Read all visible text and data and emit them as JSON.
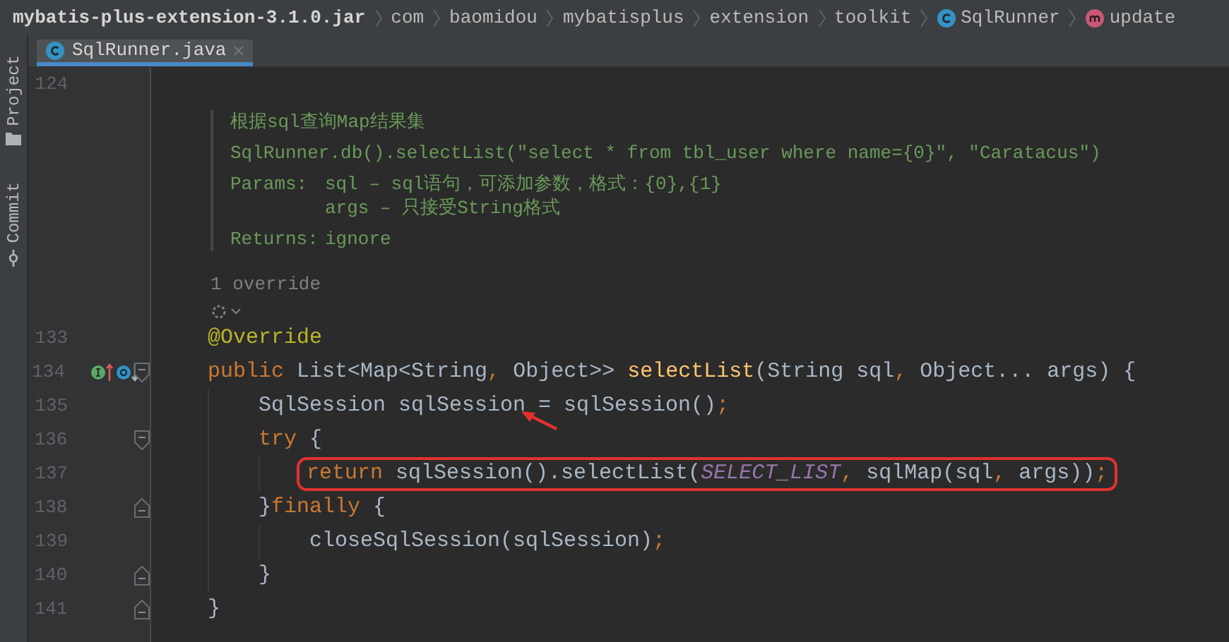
{
  "breadcrumbs": [
    {
      "text": "mybatis-plus-extension-3.1.0.jar",
      "kind": "archive"
    },
    {
      "text": "com",
      "kind": "package"
    },
    {
      "text": "baomidou",
      "kind": "package"
    },
    {
      "text": "mybatisplus",
      "kind": "package"
    },
    {
      "text": "extension",
      "kind": "package"
    },
    {
      "text": "toolkit",
      "kind": "package"
    },
    {
      "text": "SqlRunner",
      "kind": "class"
    },
    {
      "text": "update",
      "kind": "method"
    }
  ],
  "side_tabs": [
    {
      "label": "Project",
      "kind": "folder"
    },
    {
      "label": "Commit",
      "kind": "commit"
    }
  ],
  "tabs": [
    {
      "label": "SqlRunner.java",
      "selected": true
    }
  ],
  "editor": {
    "first_line": {
      "number": "124"
    },
    "doc": {
      "summary": "根据sql查询Map结果集",
      "example": "SqlRunner.db().selectList(\"select * from tbl_user where name={0}\", \"Caratacus\")",
      "params_label": "Params:",
      "params": [
        "sql – sql语句，可添加参数，格式：{0},{1}",
        "args – 只接受String格式"
      ],
      "returns_label": "Returns:",
      "returns": "ignore"
    },
    "usage_hint": "1 override",
    "lines": [
      {
        "number": "133",
        "tokens": [
          {
            "text": "@Override",
            "kind": "annotation"
          }
        ]
      },
      {
        "number": "134",
        "fold_start": true,
        "implements": true,
        "overridden": true,
        "tokens": [
          {
            "text": "public ",
            "kind": "keyword"
          },
          {
            "text": "List<Map<String",
            "kind": "plain"
          },
          {
            "text": ", ",
            "kind": "keyword"
          },
          {
            "text": "Object>> ",
            "kind": "plain"
          },
          {
            "text": "selectList",
            "kind": "method"
          },
          {
            "text": "(String sql",
            "kind": "plain"
          },
          {
            "text": ", ",
            "kind": "keyword"
          },
          {
            "text": "Object... args) {",
            "kind": "plain"
          }
        ],
        "children": [
          {
            "number": "135",
            "arrow": true,
            "tokens": [
              {
                "text": "SqlSession sqlSession = sqlSession()",
                "kind": "plain"
              },
              {
                "text": ";",
                "kind": "keyword"
              }
            ]
          },
          {
            "number": "136",
            "fold_start": true,
            "tokens": [
              {
                "text": "try ",
                "kind": "keyword"
              },
              {
                "text": "{",
                "kind": "plain"
              }
            ],
            "children": [
              {
                "number": "137",
                "boxed": true,
                "tokens": [
                  {
                    "text": "return ",
                    "kind": "keyword"
                  },
                  {
                    "text": "sqlSession().selectList(",
                    "kind": "plain"
                  },
                  {
                    "text": "SELECT_LIST",
                    "kind": "constant"
                  },
                  {
                    "text": ", ",
                    "kind": "keyword"
                  },
                  {
                    "text": "sqlMap(sql",
                    "kind": "plain"
                  },
                  {
                    "text": ", ",
                    "kind": "keyword"
                  },
                  {
                    "text": "args))",
                    "kind": "plain"
                  },
                  {
                    "text": ";",
                    "kind": "keyword"
                  }
                ]
              }
            ]
          },
          {
            "number": "138",
            "fold_end": true,
            "tokens": [
              {
                "text": "}",
                "kind": "plain"
              },
              {
                "text": "finally ",
                "kind": "keyword"
              },
              {
                "text": "{",
                "kind": "plain"
              }
            ],
            "children": [
              {
                "number": "139",
                "tokens": [
                  {
                    "text": "closeSqlSession(sqlSession)",
                    "kind": "plain"
                  },
                  {
                    "text": ";",
                    "kind": "keyword"
                  }
                ]
              }
            ]
          },
          {
            "number": "140",
            "fold_end": true,
            "tokens": [
              {
                "text": "}",
                "kind": "plain"
              }
            ]
          }
        ]
      },
      {
        "number": "141",
        "fold_end": true,
        "tokens": [
          {
            "text": "}",
            "kind": "plain"
          }
        ]
      }
    ]
  }
}
